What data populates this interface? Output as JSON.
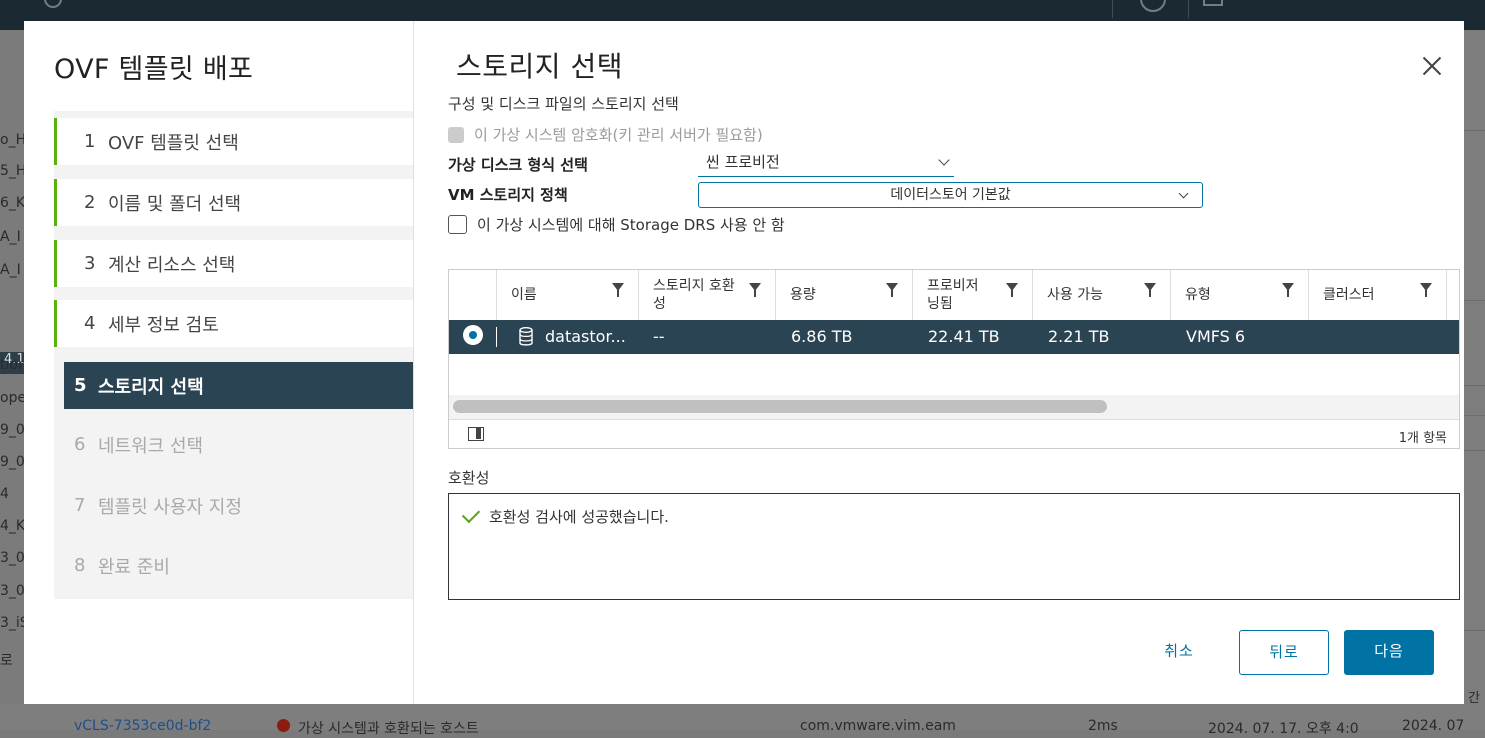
{
  "dialog": {
    "wizard_title": "OVF 템플릿 배포",
    "steps": [
      {
        "num": "1",
        "label": "OVF 템플릿 선택",
        "state": "done"
      },
      {
        "num": "2",
        "label": "이름 및 폴더 선택",
        "state": "done"
      },
      {
        "num": "3",
        "label": "계산 리소스 선택",
        "state": "done"
      },
      {
        "num": "4",
        "label": "세부 정보 검토",
        "state": "done"
      },
      {
        "num": "5",
        "label": "스토리지 선택",
        "state": "active"
      },
      {
        "num": "6",
        "label": "네트워크 선택",
        "state": "disabled"
      },
      {
        "num": "7",
        "label": "템플릿 사용자 지정",
        "state": "disabled"
      },
      {
        "num": "8",
        "label": "완료 준비",
        "state": "disabled"
      }
    ],
    "page_title": "스토리지 선택",
    "subtitle": "구성 및 디스크 파일의 스토리지 선택",
    "encrypt_label": "이 가상 시스템 암호화(키 관리 서버가 필요함)",
    "disk_format_label": "가상 디스크 형식 선택",
    "disk_format_value": "씬 프로비전",
    "vm_policy_label": "VM 스토리지 정책",
    "vm_policy_value": "데이터스토어 기본값",
    "drs_label": "이 가상 시스템에 대해 Storage DRS 사용 안 함",
    "grid": {
      "columns": [
        "이름",
        "스토리지 호환성",
        "용량",
        "프로비저닝됨",
        "사용 가능",
        "유형",
        "클러스터"
      ],
      "rows": [
        {
          "name": "datastor...",
          "compat": "--",
          "capacity": "6.86 TB",
          "provisioned": "22.41 TB",
          "free": "2.21 TB",
          "type": "VMFS 6",
          "cluster": ""
        }
      ],
      "item_count": "1개 항목"
    },
    "compat_label": "호환성",
    "compat_message": "호환성 검사에 성공했습니다.",
    "buttons": {
      "cancel": "취소",
      "back": "뒤로",
      "next": "다음"
    }
  },
  "background": {
    "left_fragments": [
      "o_H",
      "5_H",
      "6_K",
      "A_I",
      "A_I",
      "4.1",
      "tion",
      "ope",
      "9_0",
      "9_0",
      "4",
      "4_K",
      "3_0",
      "3_0",
      "3_iS",
      "로"
    ],
    "bottom_row": {
      "name": "vCLS-7353ce0d-bf2",
      "task": "가상 시스템과 호환되는 호스트",
      "source": "com.vmware.vim.eam",
      "duration": "2ms",
      "start": "2024. 07. 17. 오후 4:0",
      "end": "2024. 07"
    },
    "right_fragments": [
      "간"
    ]
  },
  "colors": {
    "accent": "#0072a3",
    "active_step": "#2b4453",
    "done_bar": "#59b10e",
    "success": "#5aa220"
  }
}
